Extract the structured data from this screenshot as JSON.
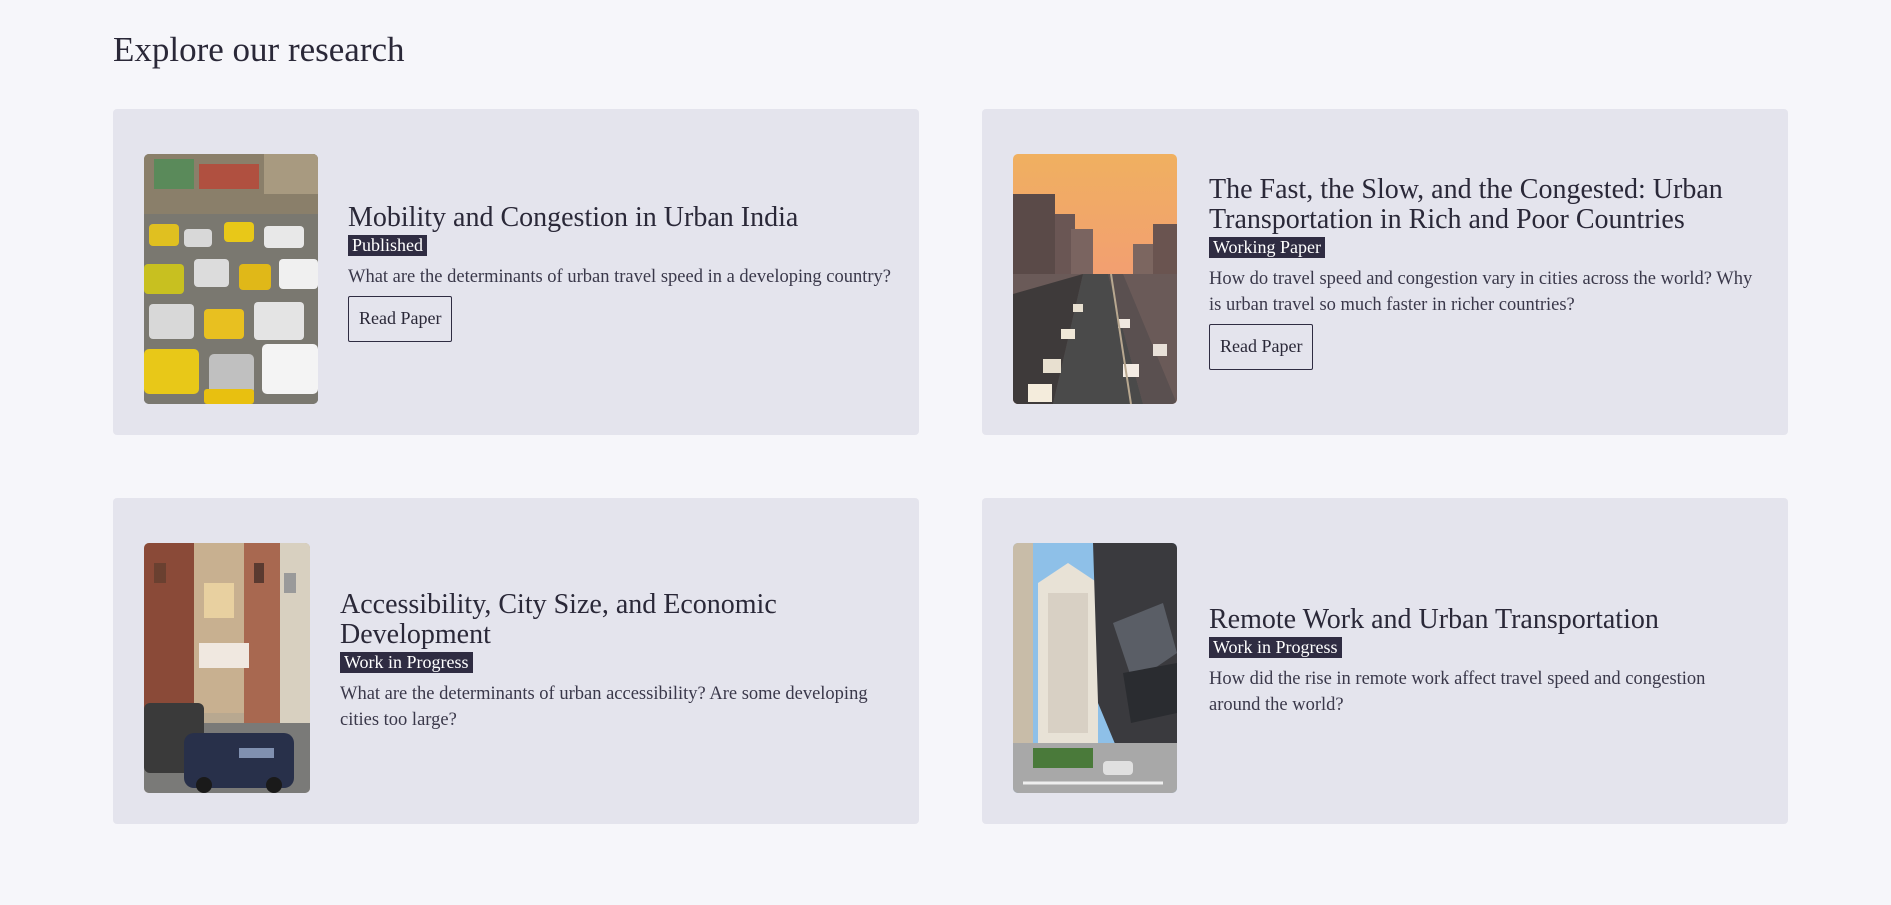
{
  "page": {
    "heading": "Explore our research"
  },
  "colors": {
    "background": "#f6f6fa",
    "card_background": "#e4e4ed",
    "badge_background": "#2f2c42",
    "text": "#2a2838"
  },
  "papers": [
    {
      "title": "Mobility and Congestion in Urban India",
      "status": "Published",
      "description": "What are the determinants of urban travel speed in a developing country?",
      "button_label": "Read Paper",
      "image": "traffic-jam-photo"
    },
    {
      "title": "The Fast, the Slow, and the Congested: Urban Transportation in Rich and Poor Countries",
      "status": "Working Paper",
      "description": "How do travel speed and congestion vary in cities across the world? Why is urban travel so much faster in richer countries?",
      "button_label": "Read Paper",
      "image": "highway-sunset-photo"
    },
    {
      "title": "Accessibility, City Size, and Economic Development",
      "status": "Work in Progress",
      "description": "What are the determinants of urban accessibility? Are some developing cities too large?",
      "image": "city-street-photo"
    },
    {
      "title": "Remote Work and Urban Transportation",
      "status": "Work in Progress",
      "description": "How did the rise in remote work affect travel speed and congestion around the world?",
      "image": "skyscrapers-photo"
    }
  ]
}
